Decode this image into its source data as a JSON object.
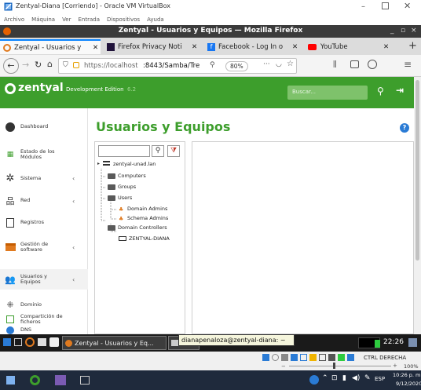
{
  "vbox": {
    "title": "Zentyal-Diana [Corriendo] - Oracle VM VirtualBox",
    "menu": [
      "Archivo",
      "Máquina",
      "Ver",
      "Entrada",
      "Dispositivos",
      "Ayuda"
    ]
  },
  "firefox": {
    "window_title": "Zentyal - Usuarios y Equipos — Mozilla Firefox",
    "tabs": [
      {
        "label": "Zentyal - Usuarios y",
        "active": true
      },
      {
        "label": "Firefox Privacy Noti",
        "active": false
      },
      {
        "label": "Facebook - Log In o",
        "active": false
      },
      {
        "label": "YouTube",
        "active": false
      }
    ],
    "url_host": "https://localhost",
    "url_path": ":8443/Samba/Tre",
    "zoom": "80%"
  },
  "zentyal": {
    "brand": "zentyal",
    "edition": "Development Edition",
    "version": "6.2",
    "search_placeholder": "Buscar...",
    "page_title": "Usuarios y Equipos",
    "sidebar": [
      {
        "label": "Dashboard",
        "icon": "dashboard-icon",
        "chevron": ""
      },
      {
        "label": "Estado de los Módulos",
        "icon": "modules-icon",
        "chevron": ""
      },
      {
        "label": "Sistema",
        "icon": "gear-icon",
        "chevron": "‹"
      },
      {
        "label": "Red",
        "icon": "network-icon",
        "chevron": "‹"
      },
      {
        "label": "Registros",
        "icon": "logs-icon",
        "chevron": ""
      },
      {
        "label": "Gestión de software",
        "icon": "software-icon",
        "chevron": "‹"
      },
      {
        "label": "Usuarios y Equipos",
        "icon": "users-icon",
        "chevron": "‹"
      },
      {
        "label": "Dominio",
        "icon": "domain-icon",
        "chevron": ""
      },
      {
        "label": "Compartición de ficheros",
        "icon": "file-share-icon",
        "chevron": ""
      },
      {
        "label": "DNS",
        "icon": "dns-icon",
        "chevron": ""
      }
    ],
    "tree": {
      "root": "zentyal-unad.lan",
      "computers": "Computers",
      "groups": "Groups",
      "users": "Users",
      "domain_admins": "Domain Admins",
      "schema_admins": "Schema Admins",
      "domain_controllers": "Domain Controllers",
      "dc_host": "ZENTYAL-DIANA"
    }
  },
  "vm_taskbar": {
    "task1": "Zentyal - Usuarios y Eq...",
    "task2": "dia",
    "tooltip": "dianapenaloza@zentyal-diana: ~",
    "clock": "22:26"
  },
  "vbox_status": {
    "host_key": "CTRL DERECHA",
    "zoom": "100%"
  },
  "windows": {
    "lang": "ESP",
    "time": "10:26 p. m.",
    "date": "9/12/2020"
  },
  "colors": {
    "zentyal_green": "#3d9e2c",
    "firefox_title": "#3b3b3b",
    "folder": "#5a5a5a",
    "group_orange": "#e07a1f"
  }
}
